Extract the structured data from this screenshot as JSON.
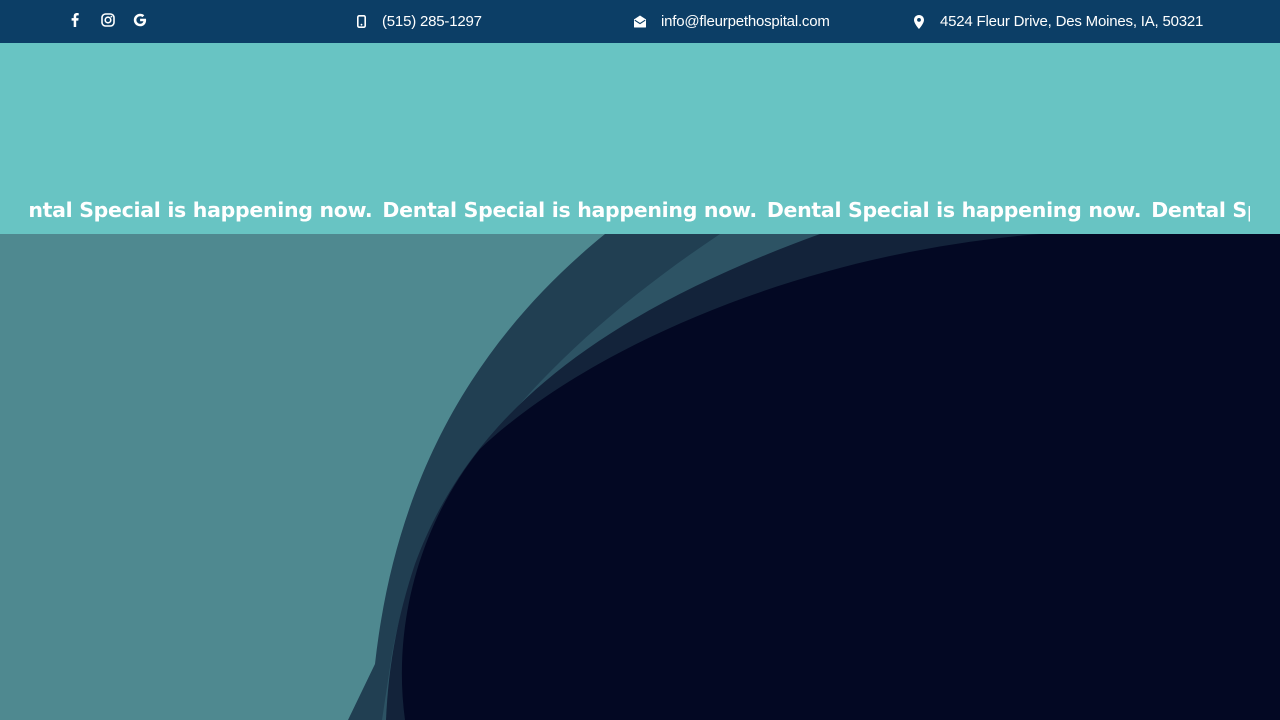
{
  "topbar": {
    "socials": [
      {
        "name": "facebook",
        "icon": "facebook-icon"
      },
      {
        "name": "instagram",
        "icon": "instagram-icon"
      },
      {
        "name": "google",
        "icon": "google-icon"
      }
    ],
    "phone": {
      "icon": "mobile-phone-icon",
      "text": "(515) 285-1297"
    },
    "email": {
      "icon": "envelope-open-icon",
      "text": "info@fleurpethospital.com"
    },
    "address": {
      "icon": "map-pin-icon",
      "text": "4524 Fleur Drive, Des Moines, IA, 50321"
    }
  },
  "banner": {
    "marquee": [
      "Dental Special is happening now.",
      "Dental Special is happening now.",
      "Dental Special is happening now.",
      "Dental Special is happening now."
    ]
  },
  "colors": {
    "topbar": "#0c3e66",
    "banner": "#68c4c3",
    "hero_left": "#4f8990",
    "hero_dark": "#030823"
  }
}
